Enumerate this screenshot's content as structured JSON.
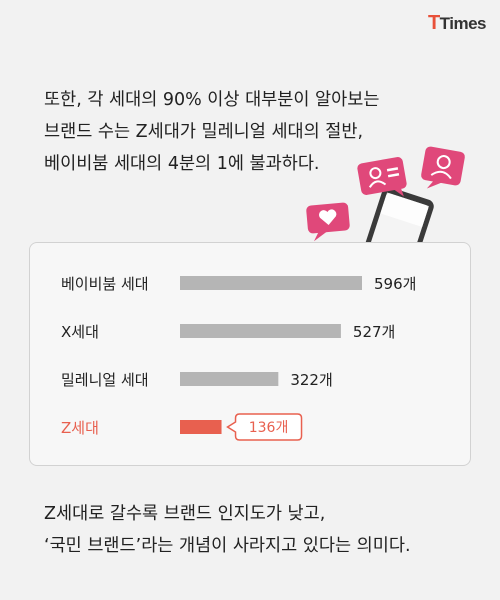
{
  "logo": {
    "first": "T",
    "rest": "Times"
  },
  "intro_lines": [
    "또한, 각 세대의 90% 이상 대부분이 알아보는",
    "브랜드 수는 Z세대가 밀레니얼 세대의 절반,",
    "베이비붐 세대의 4분의 1에 불과하다."
  ],
  "chart_data": {
    "type": "bar",
    "orientation": "horizontal",
    "categories": [
      "베이비붐 세대",
      "X세대",
      "밀레니얼 세대",
      "Z세대"
    ],
    "values": [
      596,
      527,
      322,
      136
    ],
    "value_labels": [
      "596개",
      "527개",
      "322개",
      "136개"
    ],
    "highlight_index": 3,
    "title": "",
    "xlabel": "",
    "ylabel": "",
    "xlim": [
      0,
      596
    ],
    "grid": false,
    "legend": "none"
  },
  "colors": {
    "bar": "#b5b5b5",
    "highlight": "#e8604f",
    "text": "#222222",
    "pink_icon": "#e0487a",
    "brand_red": "#e8513a"
  },
  "icons": [
    "user-chat-icon",
    "avatar-chat-icon",
    "heart-chat-icon",
    "smartphone-icon"
  ],
  "outro_lines": [
    "Z세대로 갈수록 브랜드 인지도가 낮고,",
    "‘국민 브랜드’라는 개념이 사라지고 있다는 의미다."
  ]
}
